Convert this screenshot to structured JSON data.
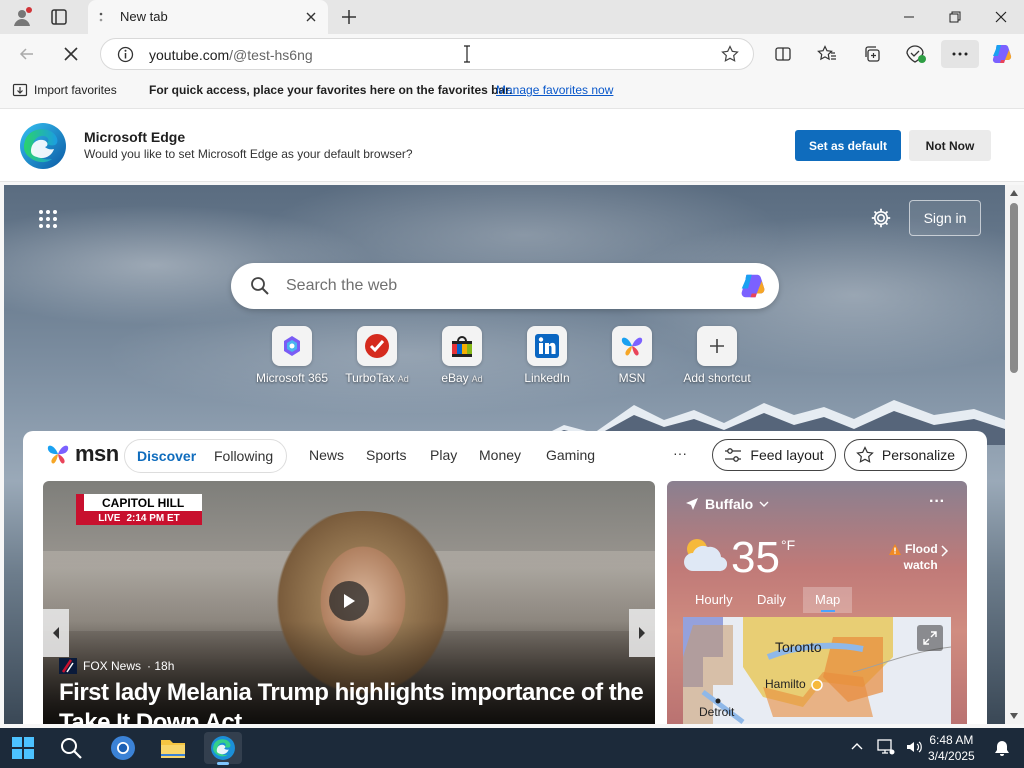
{
  "tab": {
    "title": "New tab"
  },
  "address": {
    "domain": "youtube.com",
    "path": "/@test-hs6ng"
  },
  "favorites_bar": {
    "import_label": "Import favorites",
    "message": "For quick access, place your favorites here on the favorites bar.",
    "manage_link": "Manage favorites now"
  },
  "banner": {
    "title": "Microsoft Edge",
    "subtitle": "Would you like to set Microsoft Edge as your default browser?",
    "default_button": "Set as default",
    "not_now_button": "Not Now"
  },
  "newtab": {
    "sign_in": "Sign in",
    "search_placeholder": "Search the web",
    "shortcuts": [
      {
        "label": "Microsoft 365",
        "ad": ""
      },
      {
        "label": "TurboTax",
        "ad": "Ad"
      },
      {
        "label": "eBay",
        "ad": "Ad"
      },
      {
        "label": "LinkedIn",
        "ad": ""
      },
      {
        "label": "MSN",
        "ad": ""
      },
      {
        "label": "Add shortcut",
        "ad": ""
      }
    ]
  },
  "feed": {
    "logo": "msn",
    "discover": "Discover",
    "following": "Following",
    "nav": [
      "News",
      "Sports",
      "Play",
      "Money",
      "Gaming"
    ],
    "more": "···",
    "feed_layout": "Feed layout",
    "personalize": "Personalize"
  },
  "hero": {
    "badge_top": "CAPITOL HILL",
    "badge_live": "LIVE",
    "badge_time": "2:14 PM ET",
    "source": "FOX News",
    "age": "· 18h",
    "title": "First lady Melania Trump highlights importance of the Take It Down Act"
  },
  "weather": {
    "location": "Buffalo",
    "more": "···",
    "temperature": "35",
    "unit": "°F",
    "alert_line1": "Flood",
    "alert_line2": "watch",
    "tabs": [
      "Hourly",
      "Daily",
      "Map"
    ],
    "active_tab": "Map",
    "map_labels": [
      "Toronto",
      "Hamilto",
      "Detroit"
    ]
  },
  "taskbar": {
    "time": "6:48 AM",
    "date": "3/4/2025"
  },
  "colors": {
    "accent": "#0f6cbd",
    "taskbar": "#1c2a3a",
    "fox_red": "#c8102e"
  }
}
